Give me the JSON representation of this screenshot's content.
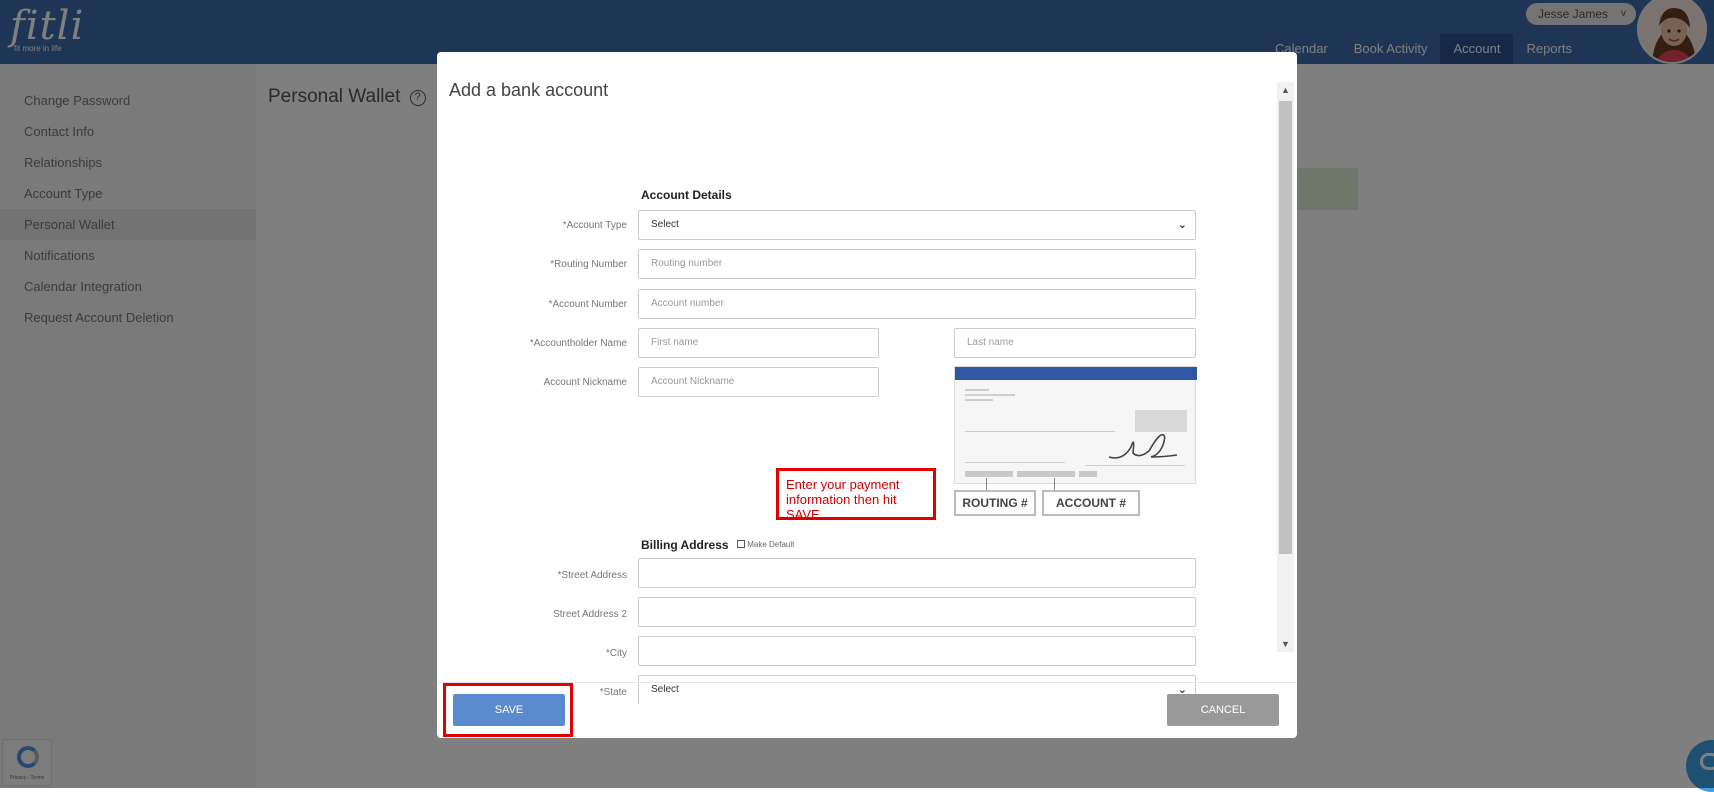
{
  "app": {
    "logo_text": "fitli",
    "logo_tagline": "fit more in life",
    "user_name": "Jesse James",
    "nav": [
      "Calendar",
      "Book Activity",
      "Account",
      "Reports"
    ],
    "nav_active": "Account"
  },
  "sidebar": {
    "items": [
      {
        "label": "Change Password"
      },
      {
        "label": "Contact Info"
      },
      {
        "label": "Relationships"
      },
      {
        "label": "Account Type"
      },
      {
        "label": "Personal Wallet"
      },
      {
        "label": "Notifications"
      },
      {
        "label": "Calendar Integration"
      },
      {
        "label": "Request Account Deletion"
      }
    ],
    "active": "Personal Wallet"
  },
  "page": {
    "title": "Personal Wallet",
    "help_glyph": "?"
  },
  "recaptcha": {
    "text": "Privacy - Terms"
  },
  "modal": {
    "title": "Add a bank account",
    "account_details": {
      "heading": "Account Details",
      "account_type": {
        "label": "*Account Type",
        "value": "Select"
      },
      "routing_number": {
        "label": "*Routing Number",
        "placeholder": "Routing number"
      },
      "account_number": {
        "label": "*Account Number",
        "placeholder": "Account number"
      },
      "holder_name": {
        "label": "*Accountholder Name",
        "first_placeholder": "First name",
        "last_placeholder": "Last name"
      },
      "nickname": {
        "label": "Account Nickname",
        "placeholder": "Account Nickname"
      }
    },
    "check_image": {
      "routing_label": "ROUTING #",
      "account_label": "ACCOUNT #"
    },
    "annotation": {
      "line1": "Enter your payment",
      "line2": "information then hit SAVE."
    },
    "billing": {
      "heading": "Billing Address",
      "make_default": "Make Default",
      "street": {
        "label": "*Street Address"
      },
      "street2": {
        "label": "Street Address 2"
      },
      "city": {
        "label": "*City"
      },
      "state": {
        "label": "*State",
        "value": "Select"
      }
    },
    "buttons": {
      "save": "SAVE",
      "cancel": "CANCEL"
    }
  },
  "colors": {
    "header_blue": "#3f6aad",
    "save_blue": "#5a8ad0",
    "cancel_gray": "#999999",
    "highlight_red": "#e10000"
  }
}
